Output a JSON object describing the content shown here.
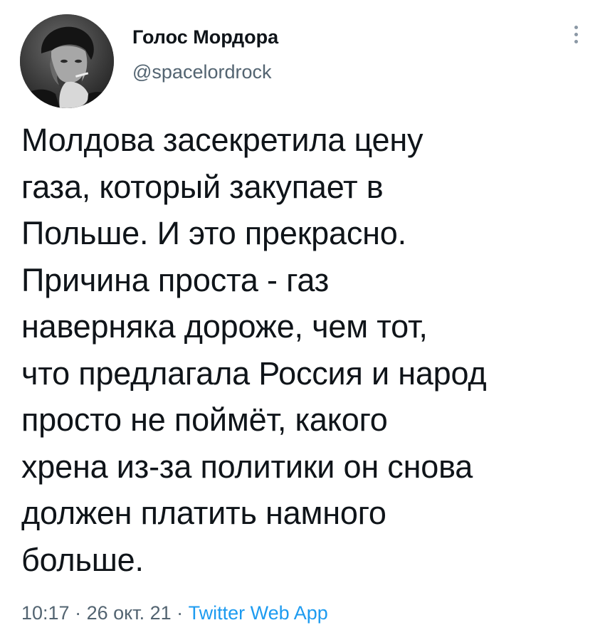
{
  "author": {
    "name": "Голос Мордора",
    "handle": "@spacelordrock"
  },
  "tweet": {
    "lines": [
      "Молдова засекретила цену",
      "газа, который закупает в",
      "Польше. И это прекрасно.",
      "Причина проста - газ",
      "наверняка дороже, чем тот,",
      "что предлагала Россия и народ",
      "просто не поймёт, какого",
      "хрена из-за политики он снова",
      "должен платить намного",
      "больше."
    ]
  },
  "meta": {
    "time": "10:17",
    "separator": " · ",
    "date": "26 окт. 21",
    "source": "Twitter Web App"
  },
  "icons": {
    "more": "more-vertical-icon",
    "avatar": "avatar-photo"
  },
  "colors": {
    "text": "#0f1419",
    "secondary": "#536471",
    "link": "#1d9bf0"
  }
}
